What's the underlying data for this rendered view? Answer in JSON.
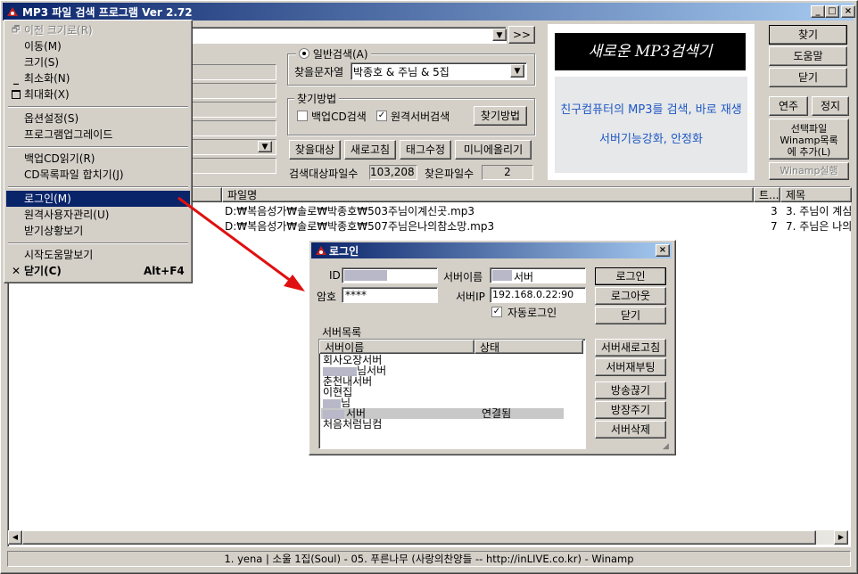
{
  "window": {
    "title": "MP3 파일 검색 프로그램 Ver 2.72",
    "min": "_",
    "max": "□",
    "close": "×"
  },
  "top": {
    "browse_btn": ">>"
  },
  "search": {
    "mode_label": "일반검색(A)",
    "query_label": "찾을문자열",
    "query_value": "박종호 & 주님 & 5집",
    "method_label": "찾기방법",
    "backup_cd": "백업CD검색",
    "backup_cd_checked": false,
    "remote": "원격서버검색",
    "remote_checked": true,
    "method_btn": "찾기방법",
    "target_btn": "찾을대상",
    "refresh_btn": "새로고침",
    "tag_btn": "태그수정",
    "mini_btn": "미니에올리기",
    "count_label": "검색대상파일수",
    "count_value": "103,208",
    "found_label": "찾은파일수",
    "found_value": "2"
  },
  "banner": {
    "title": "새로운 MP3검색기",
    "line1": "친구컴퓨터의 MP3를 검색, 바로 재생",
    "line2": "서버기능강화, 안정화"
  },
  "right": {
    "find": "찾기",
    "help": "도움말",
    "close": "닫기",
    "play": "연주",
    "stop": "정지",
    "add": "선택파일 Winamp목록 에 추가(L)",
    "winamp": "Winamp실행"
  },
  "table": {
    "headers": [
      "파일명",
      "트...",
      "제목"
    ],
    "rows": [
      {
        "file": "D:₩복음성가₩솔로₩박종호₩503주님이계신곳.mp3",
        "track": "3",
        "title": "3. 주님이 계심"
      },
      {
        "file": "D:₩복음성가₩솔로₩박종호₩507주님은나의참소망.mp3",
        "track": "7",
        "title": "7. 주님은 나의"
      }
    ]
  },
  "sysmenu": {
    "items": [
      {
        "label": "이전 크기로(R)",
        "icon": "restore",
        "disabled": true
      },
      {
        "label": "이동(M)"
      },
      {
        "label": "크기(S)"
      },
      {
        "label": "최소화(N)",
        "icon": "minimize"
      },
      {
        "label": "최대화(X)",
        "icon": "maximize"
      },
      {
        "sep": true
      },
      {
        "label": "옵션설정(S)"
      },
      {
        "label": "프로그램업그레이드"
      },
      {
        "sep": true
      },
      {
        "label": "백업CD읽기(R)"
      },
      {
        "label": "CD목록파일 합치기(J)"
      },
      {
        "sep": true
      },
      {
        "label": "로그인(M)",
        "selected": true
      },
      {
        "label": "원격사용자관리(U)"
      },
      {
        "label": "받기상황보기"
      },
      {
        "sep": true
      },
      {
        "label": "시작도움말보기"
      },
      {
        "label": "닫기(C)",
        "shortcut": "Alt+F4",
        "icon": "close",
        "bold": true
      }
    ]
  },
  "login": {
    "title": "로그인",
    "id_label": "ID",
    "pw_label": "암호",
    "pw_value": "****",
    "server_name_label": "서버이름",
    "server_name_value": "서버",
    "server_ip_label": "서버IP",
    "server_ip_value": "192.168.0.22:90",
    "auto_login": "자동로그인",
    "auto_login_checked": true,
    "login_btn": "로그인",
    "logout_btn": "로그아웃",
    "close_btn": "닫기",
    "list_label": "서버목록",
    "col_name": "서버이름",
    "col_state": "상태",
    "servers": [
      {
        "name": "회사오장서버",
        "state": ""
      },
      {
        "name": "님서버",
        "state": ""
      },
      {
        "name": "춘천내서버",
        "state": ""
      },
      {
        "name": "이현집",
        "state": ""
      },
      {
        "name": "님",
        "state": ""
      },
      {
        "name": "서버",
        "state": "연결됨"
      },
      {
        "name": "처음처럼님컴",
        "state": ""
      }
    ],
    "refresh_btn": "서버새로고침",
    "reboot_btn": "서버재부팅",
    "bcast_stop_btn": "방송끊기",
    "bcast_give_btn": "방장주기",
    "delete_btn": "서버삭제"
  },
  "status": {
    "text": "1. yena | 소울 1집(Soul) - 05. 푸른나무 (사랑의찬양들 -- http://inLIVE.co.kr) - Winamp"
  },
  "colors": {
    "face": "#d4d0c8",
    "title_start": "#0a246a",
    "title_end": "#a6caf0",
    "select": "#0a246a",
    "banner_black": "#000000",
    "banner_text": "#1f57c2",
    "arrow": "#e01010"
  }
}
